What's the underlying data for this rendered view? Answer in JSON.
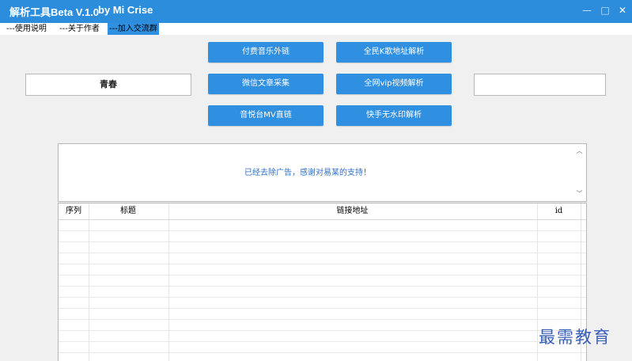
{
  "window": {
    "title": "解析工具Beta V.1.0",
    "author": "by Mi Crise",
    "minimize": "—",
    "maximize": "□",
    "close": "✕"
  },
  "menu": {
    "items": [
      {
        "label": "---使用说明"
      },
      {
        "label": "---关于作者"
      },
      {
        "label": "---加入交流群"
      }
    ]
  },
  "left_input": {
    "value": "青春"
  },
  "right_input": {
    "value": ""
  },
  "buttons": {
    "b1": "付费音乐外链",
    "b2": "全民K歌地址解析",
    "b3": "微信文章采集",
    "b4": "全网vip视频解析",
    "b5": "音悦台MV直链",
    "b6": "快手无水印解析"
  },
  "message": {
    "text": "已经去除广告，感谢对易某的支持！"
  },
  "table": {
    "columns": [
      "序列",
      "标题",
      "链接地址",
      "id"
    ],
    "rows": []
  },
  "watermark": "最需教育",
  "colors": {
    "accent": "#2f8fe0",
    "titlebar": "#2b8ddb"
  }
}
